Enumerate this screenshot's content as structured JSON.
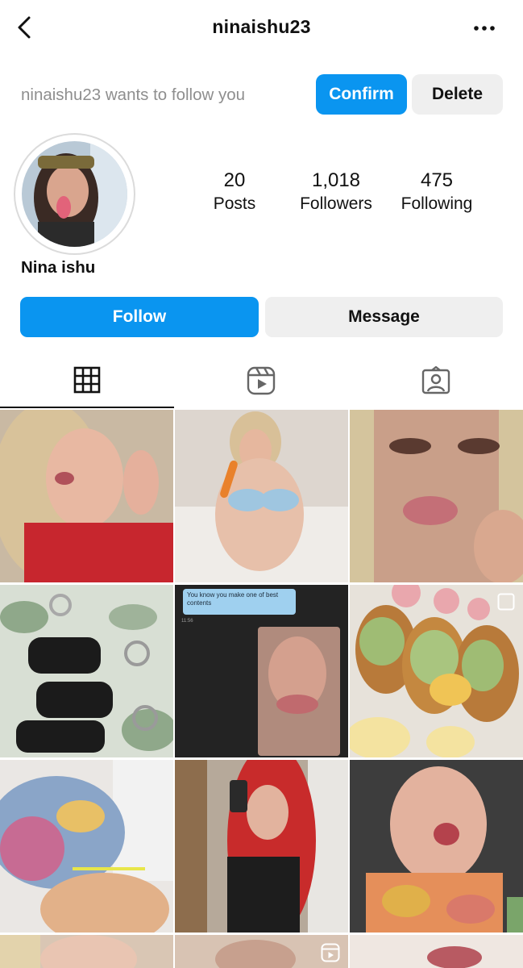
{
  "header": {
    "title": "ninaishu23",
    "back_icon": "chevron-left-icon",
    "more_icon": "more-horizontal-icon"
  },
  "request": {
    "text": "ninaishu23 wants to follow you",
    "confirm_label": "Confirm",
    "delete_label": "Delete"
  },
  "profile": {
    "display_name": "Nina ishu",
    "stats": [
      {
        "value": "20",
        "label": "Posts"
      },
      {
        "value": "1,018",
        "label": "Followers"
      },
      {
        "value": "475",
        "label": "Following"
      }
    ]
  },
  "actions": {
    "follow_label": "Follow",
    "message_label": "Message"
  },
  "tabs": [
    {
      "icon": "grid-icon",
      "active": true
    },
    {
      "icon": "reels-icon",
      "active": false
    },
    {
      "icon": "tagged-icon",
      "active": false
    }
  ],
  "posts": [
    {
      "caption": ""
    },
    {
      "caption": ""
    },
    {
      "caption": ""
    },
    {
      "caption": ""
    },
    {
      "caption": "You know you make one of best contents",
      "time": "11:56"
    },
    {
      "caption": ""
    },
    {
      "caption": ""
    },
    {
      "caption": ""
    },
    {
      "caption": ""
    }
  ],
  "colors": {
    "accent": "#0a95f0",
    "secondary_button": "#efefef",
    "muted_text": "#8e8e8e"
  }
}
